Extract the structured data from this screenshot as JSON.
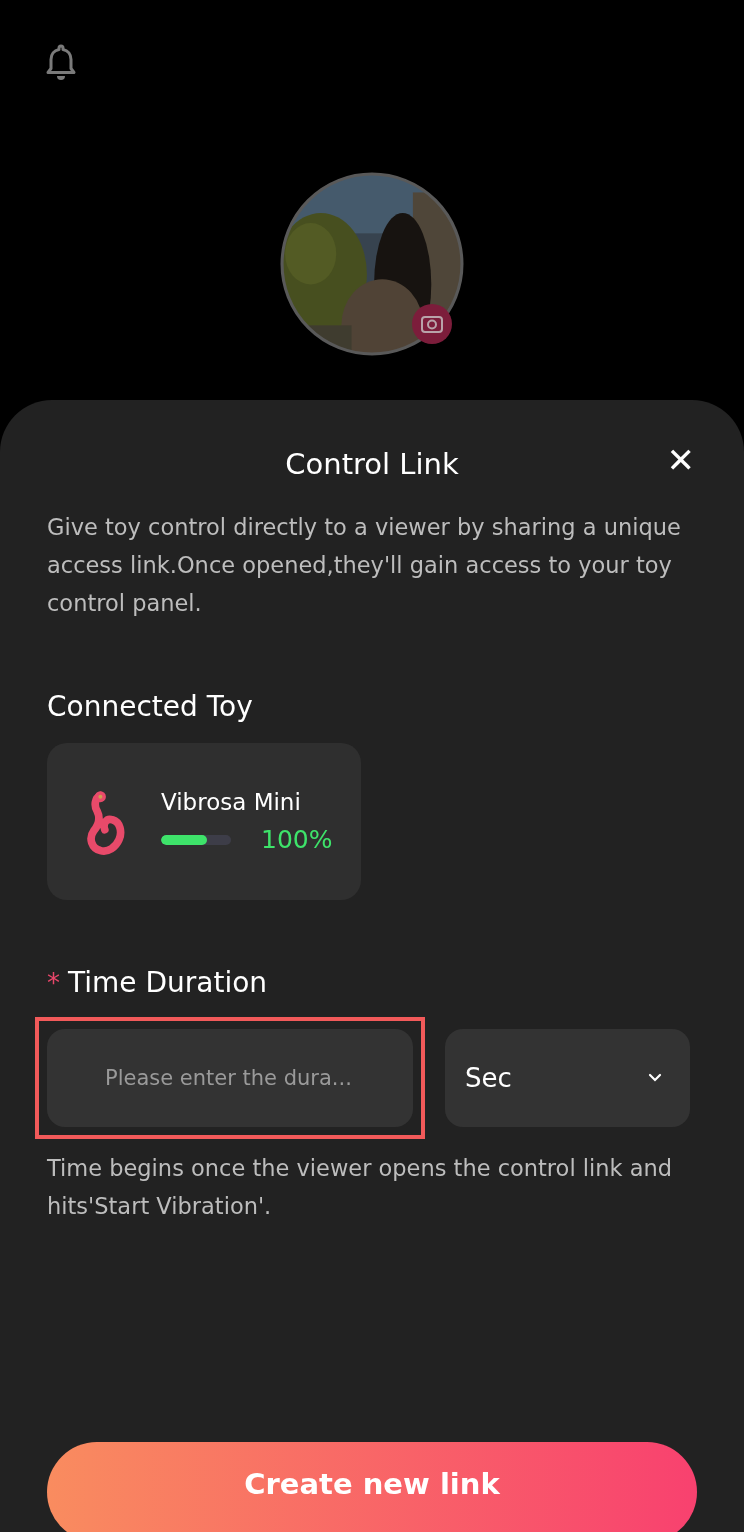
{
  "sheet": {
    "title": "Control Link",
    "close": "✕",
    "description": "Give toy control directly to a viewer by sharing a unique access link.Once opened,they'll gain access to your toy control panel.",
    "connected_toy": {
      "heading": "Connected Toy",
      "name": "Vibrosa Mini",
      "level": 0.66,
      "battery": "100%"
    },
    "duration": {
      "required_mark": "*",
      "label": "Time Duration",
      "placeholder": "Please enter the dura...",
      "highlighted": true,
      "unit": "Sec"
    },
    "hint": "Time begins once the viewer opens the control link and hits'Start Vibration'.",
    "button": "Create new link"
  }
}
